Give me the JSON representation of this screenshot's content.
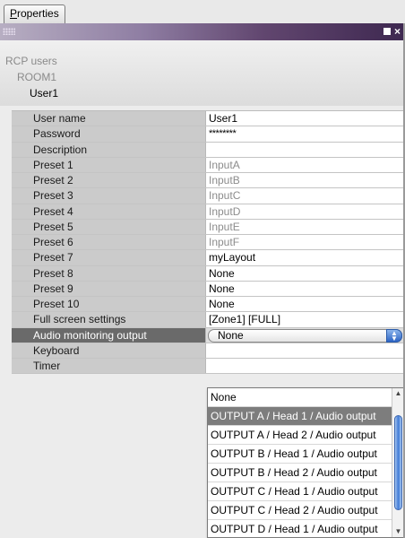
{
  "tab": {
    "label_u": "P",
    "label_rest": "roperties"
  },
  "window": {
    "close_glyph": "×"
  },
  "tree": {
    "root": "RCP users",
    "room": "ROOM1",
    "user": "User1"
  },
  "rows": [
    {
      "key": "User name",
      "value": "User1",
      "style": ""
    },
    {
      "key": "Password",
      "value": "********",
      "style": "pass"
    },
    {
      "key": "Description",
      "value": "",
      "style": ""
    },
    {
      "key": "Preset 1",
      "value": "InputA",
      "style": "dim"
    },
    {
      "key": "Preset 2",
      "value": "InputB",
      "style": "dim"
    },
    {
      "key": "Preset 3",
      "value": "InputC",
      "style": "dim"
    },
    {
      "key": "Preset 4",
      "value": "InputD",
      "style": "dim"
    },
    {
      "key": "Preset 5",
      "value": "InputE",
      "style": "dim"
    },
    {
      "key": "Preset 6",
      "value": "InputF",
      "style": "dim"
    },
    {
      "key": "Preset 7",
      "value": "myLayout",
      "style": ""
    },
    {
      "key": "Preset 8",
      "value": "None",
      "style": ""
    },
    {
      "key": "Preset 9",
      "value": "None",
      "style": ""
    },
    {
      "key": "Preset 10",
      "value": "None",
      "style": ""
    },
    {
      "key": "Full screen settings",
      "value": "[Zone1] [FULL]",
      "style": ""
    },
    {
      "key": "Audio monitoring output",
      "value": "None",
      "style": "combo"
    },
    {
      "key": "Keyboard",
      "value": "",
      "style": ""
    },
    {
      "key": "Timer",
      "value": "",
      "style": ""
    }
  ],
  "dropdown": {
    "options": [
      "None",
      "OUTPUT A / Head 1 / Audio output",
      "OUTPUT A / Head 2 / Audio output",
      "OUTPUT B / Head 1 / Audio output",
      "OUTPUT B / Head 2 / Audio output",
      "OUTPUT C / Head 1 / Audio output",
      "OUTPUT C / Head 2 / Audio output",
      "OUTPUT D / Head 1 / Audio output"
    ],
    "highlighted_index": 1
  },
  "colors": {
    "title_start": "#b7aec2",
    "title_end": "#3e2850",
    "selected_row": "#6a6a6a",
    "highlight": "#7d7d7d"
  }
}
